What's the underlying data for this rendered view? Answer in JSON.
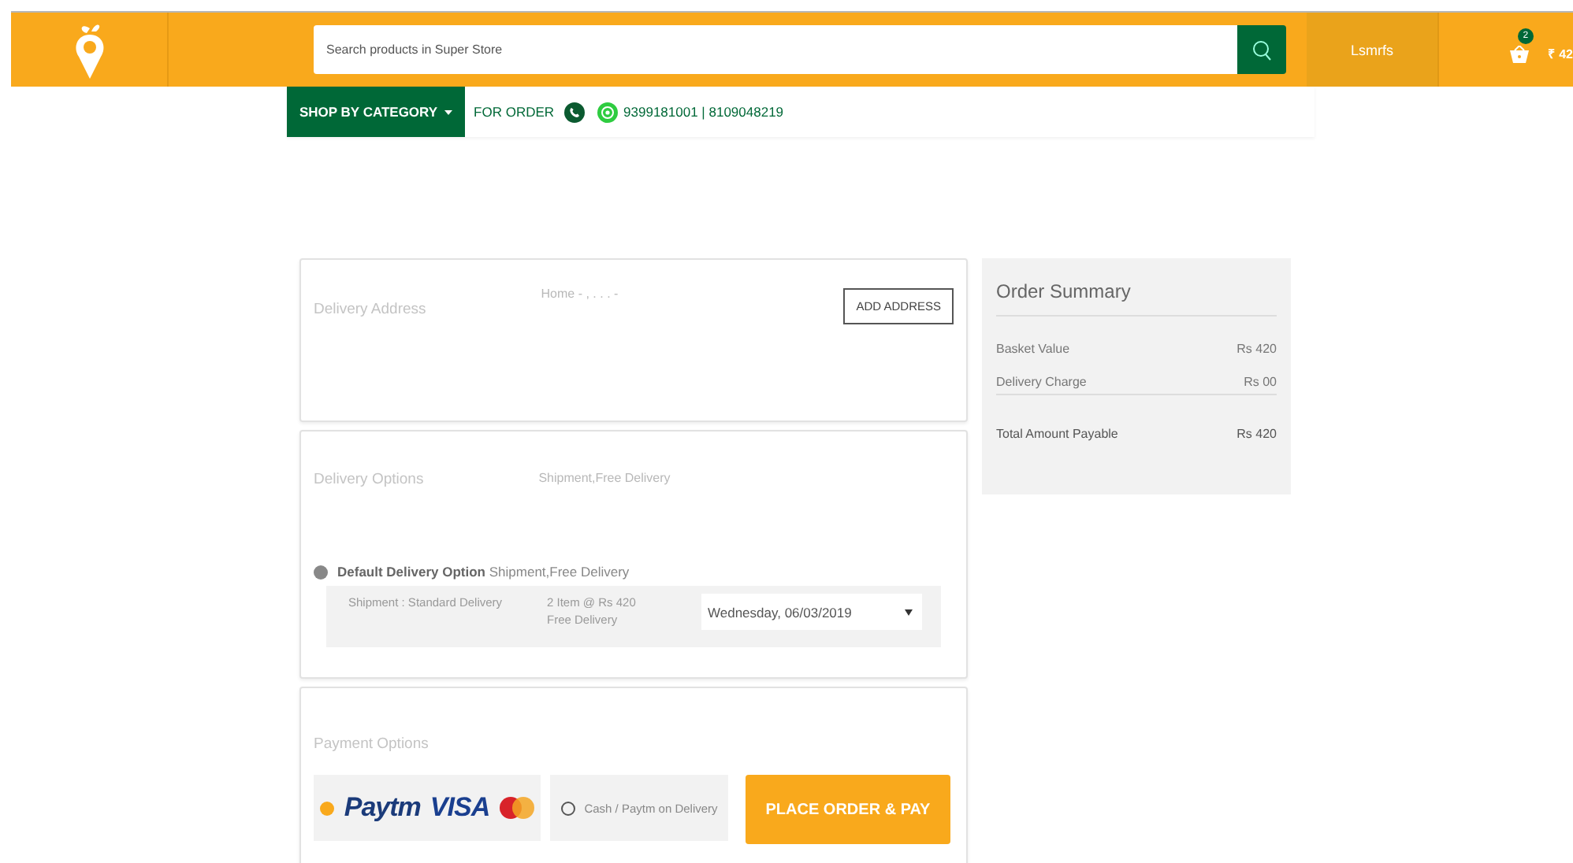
{
  "header": {
    "search": {
      "placeholder": "Search products in Super Store"
    },
    "user": "Lsmrfs",
    "cart": {
      "count": "2",
      "total": "₹ 42"
    }
  },
  "nav": {
    "category_button": "SHOP BY CATEGORY",
    "order_label": "FOR ORDER",
    "phones": "9399181001 | 8109048219"
  },
  "delivery_address": {
    "title": "Delivery Address",
    "address": "Home - , . . . -",
    "button": "ADD ADDRESS"
  },
  "delivery_options": {
    "title": "Delivery Options",
    "summary": "Shipment,Free Delivery",
    "options": [
      {
        "label": "Default Delivery Option",
        "detail": "Shipment,Free Delivery",
        "selected": true
      }
    ],
    "shipment": {
      "type": "Shipment : Standard Delivery",
      "items": "2 Item @ Rs 420",
      "fee": "Free Delivery",
      "date": "Wednesday, 06/03/2019"
    }
  },
  "payment": {
    "title": "Payment Options",
    "options": [
      {
        "kind": "cards",
        "brands": [
          "Paytm",
          "VISA"
        ],
        "selected": true
      },
      {
        "kind": "cash",
        "label": "Cash / Paytm on Delivery",
        "selected": false
      }
    ],
    "button": "PLACE ORDER & PAY"
  },
  "order_summary": {
    "title": "Order Summary",
    "rows": [
      {
        "label": "Basket Value",
        "value": "Rs 420"
      },
      {
        "label": "Delivery Charge",
        "value": "Rs 00"
      }
    ],
    "total": {
      "label": "Total Amount Payable",
      "value": "Rs 420"
    }
  }
}
